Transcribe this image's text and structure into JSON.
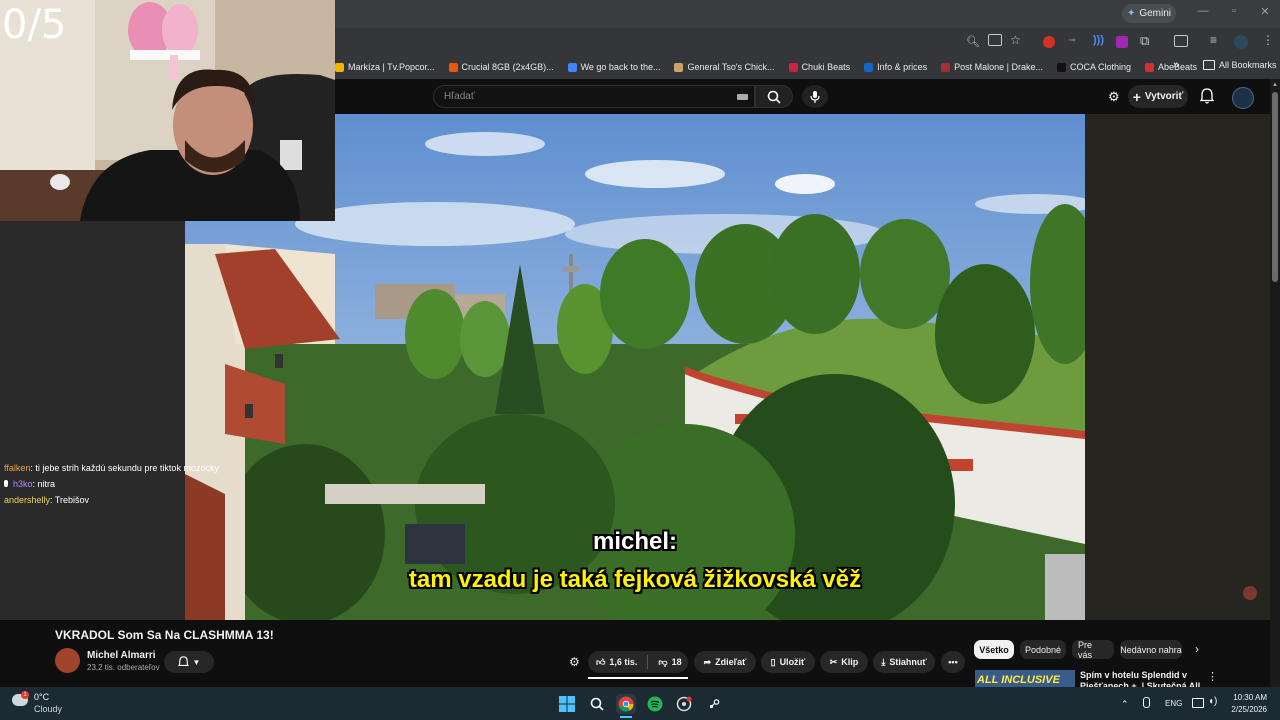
{
  "overlay": {
    "counter": "0/5"
  },
  "chrome": {
    "gemini_label": "Gemini",
    "bookmarks": [
      {
        "label": "Markíza | Tv.Popcor...",
        "color": "#f4b400"
      },
      {
        "label": "Crucial 8GB (2x4GB)...",
        "color": "#e8590c"
      },
      {
        "label": "We go back to the...",
        "color": "#4285f4"
      },
      {
        "label": "General Tso's Chick...",
        "color": "#c9a36b"
      },
      {
        "label": "Chuki Beats",
        "color": "#cc2244"
      },
      {
        "label": "Info & prices",
        "color": "#1565c0"
      },
      {
        "label": "Post Malone | Drake...",
        "color": "#a0303a"
      },
      {
        "label": "COCA Clothing",
        "color": "#111111"
      },
      {
        "label": "AbeBeats",
        "color": "#d32f2f"
      }
    ],
    "bookmarks_overflow": "»",
    "all_bookmarks": "All Bookmarks"
  },
  "youtube": {
    "search_placeholder": "Hľadať",
    "create_label": "Vytvoriť",
    "video_title": "VKRADOL Som Sa Na CLASHMMA 13!",
    "channel_name": "Michel Almarri",
    "subscribers": "23,2 tis. odberateľov",
    "likes": "1,6 tis.",
    "dislikes": "18",
    "share_label": "Zdieľať",
    "save_label": "Uložiť",
    "clip_label": "Klip",
    "download_label": "Stiahnuť",
    "more_label": "•••",
    "chips": [
      "Všetko",
      "Podobné",
      "Pre vás",
      "Nedávno nahra"
    ],
    "recommend_title_1": "Spím v hotelu Splendid v",
    "recommend_title_2": "Piešťanech +. | Skutečná All",
    "recommend_thumb_text": "ALL INCLUSIVE"
  },
  "subtitles": {
    "speaker": "michel:",
    "line": "tam vzadu je taká fejková žižkovská věž"
  },
  "chat": [
    {
      "user": "ffalken",
      "user_color": "#e8a33c",
      "message": ": ti jebe strih každú sekundu pre tiktok mozocky"
    },
    {
      "user": "h3ko",
      "user_color": "#b98cff",
      "message": ": nitra"
    },
    {
      "user": "andershelly",
      "user_color": "#f0d25a",
      "message": ": Trebišov"
    }
  ],
  "taskbar": {
    "temperature": "0°C",
    "weather": "Cloudy",
    "weather_badge": "1",
    "language": "ENG",
    "time": "10:30 AM",
    "date": "2/25/2026"
  }
}
